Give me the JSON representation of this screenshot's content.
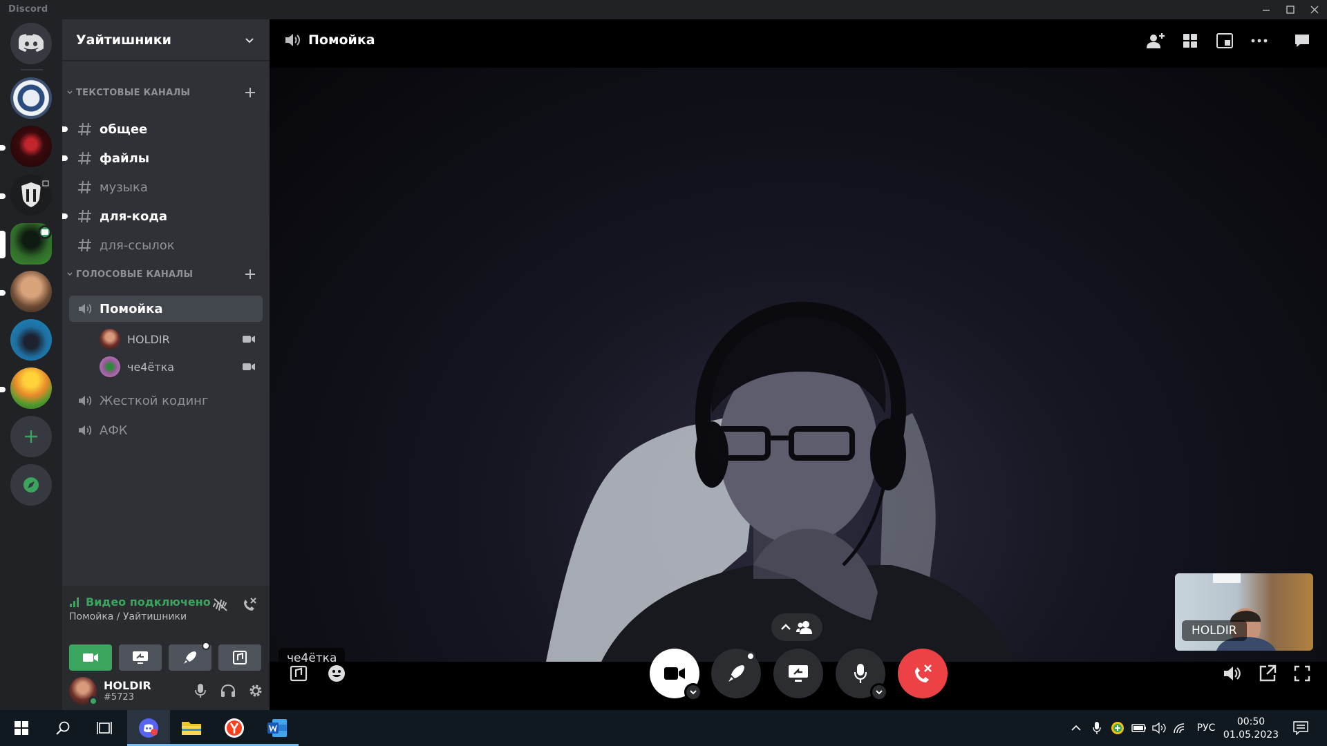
{
  "window": {
    "title": "Discord"
  },
  "server": {
    "name": "Уайтишники",
    "text_category": "ТЕКСТОВЫЕ КАНАЛЫ",
    "voice_category": "ГОЛОСОВЫЕ КАНАЛЫ",
    "text_channels": [
      {
        "name": "общее",
        "unread": true
      },
      {
        "name": "файлы",
        "unread": true
      },
      {
        "name": "музыка",
        "unread": false
      },
      {
        "name": "для-кода",
        "unread": true
      },
      {
        "name": "для-ссылок",
        "unread": false
      }
    ],
    "voice_channels": [
      {
        "name": "Помойка",
        "selected": true
      },
      {
        "name": "Жесткой кодинг",
        "selected": false
      },
      {
        "name": "АФК",
        "selected": false
      }
    ],
    "voice_users": [
      {
        "name": "HOLDIR",
        "camera_on": true
      },
      {
        "name": "че4ётка",
        "camera_on": true
      }
    ]
  },
  "voice_connection": {
    "status": "Видео подключено",
    "location": "Помойка / Уайтишники"
  },
  "user": {
    "name": "HOLDIR",
    "tag": "#5723",
    "status_color": "#3ba55d"
  },
  "call": {
    "channel_name": "Помойка",
    "main_video_label": "че4ётка",
    "pip_label": "HOLDIR"
  },
  "taskbar": {
    "language": "РУС",
    "time": "00:50",
    "date": "01.05.2023"
  },
  "colors": {
    "accent_green": "#3ba55d",
    "danger_red": "#ed4245",
    "sidebar": "#2f3136",
    "rail": "#202225"
  }
}
